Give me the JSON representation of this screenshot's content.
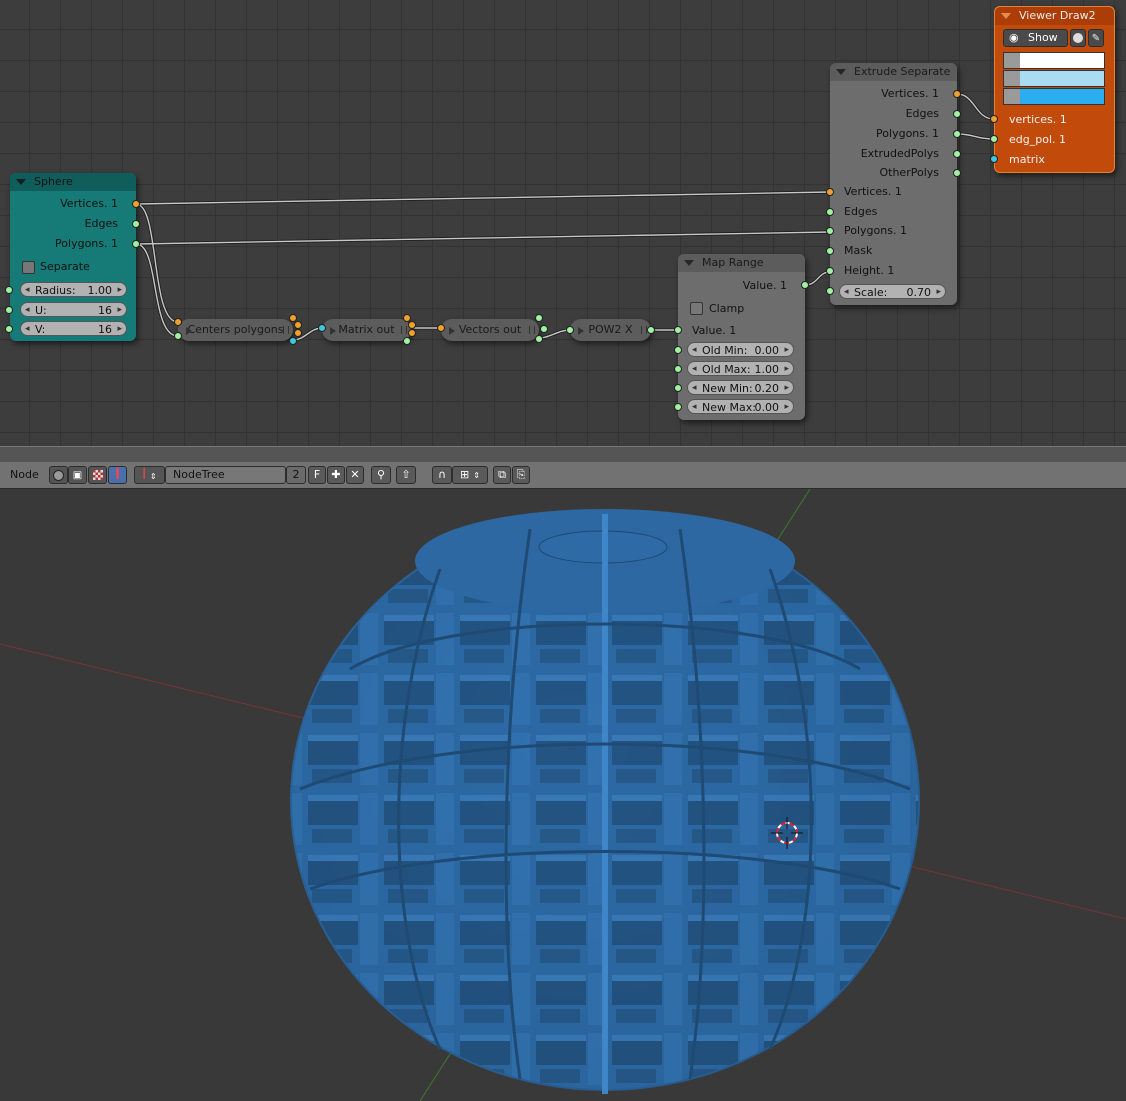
{
  "nodes": {
    "sphere": {
      "title": "Sphere",
      "outputs": [
        "Vertices. 1",
        "Edges",
        "Polygons. 1"
      ],
      "separate_label": "Separate",
      "radius": {
        "label": "Radius:",
        "value": "1.00"
      },
      "u": {
        "label": "U:",
        "value": "16"
      },
      "v": {
        "label": "V:",
        "value": "16"
      }
    },
    "centers_polygons": {
      "title": "Centers polygons"
    },
    "matrix_out": {
      "title": "Matrix out"
    },
    "vectors_out": {
      "title": "Vectors out"
    },
    "pow2": {
      "title": "POW2 X"
    },
    "map_range": {
      "title": "Map Range",
      "output": "Value. 1",
      "clamp_label": "Clamp",
      "input": "Value. 1",
      "old_min": {
        "label": "Old Min:",
        "value": "0.00"
      },
      "old_max": {
        "label": "Old Max:",
        "value": "1.00"
      },
      "new_min": {
        "label": "New Min:",
        "value": "0.20"
      },
      "new_max": {
        "label": "New Max:",
        "value": "0.00"
      }
    },
    "extrude_separate": {
      "title": "Extrude Separate",
      "outputs": [
        "Vertices. 1",
        "Edges",
        "Polygons. 1",
        "ExtrudedPolys",
        "OtherPolys"
      ],
      "inputs": [
        "Vertices. 1",
        "Edges",
        "Polygons. 1",
        "Mask",
        "Height. 1"
      ],
      "scale": {
        "label": "Scale:",
        "value": "0.70"
      }
    },
    "viewer_draw": {
      "title": "Viewer Draw2",
      "show_label": "Show",
      "inputs": [
        "vertices. 1",
        "edg_pol. 1",
        "matrix"
      ],
      "colors": [
        "#ffffff",
        "#a8dcf2",
        "#2aaef0"
      ]
    }
  },
  "header": {
    "editor_label": "Node",
    "tree_name": "NodeTree",
    "users": "2",
    "fake_user": "F"
  },
  "colors": {
    "socket_vertices": "#f0a02c",
    "socket_data": "#9ff29f",
    "socket_matrix": "#3ec8e0",
    "sphere_node": "#167a76",
    "viewer_node": "#c24a0b",
    "mesh_blue": "#2e6ba6"
  }
}
